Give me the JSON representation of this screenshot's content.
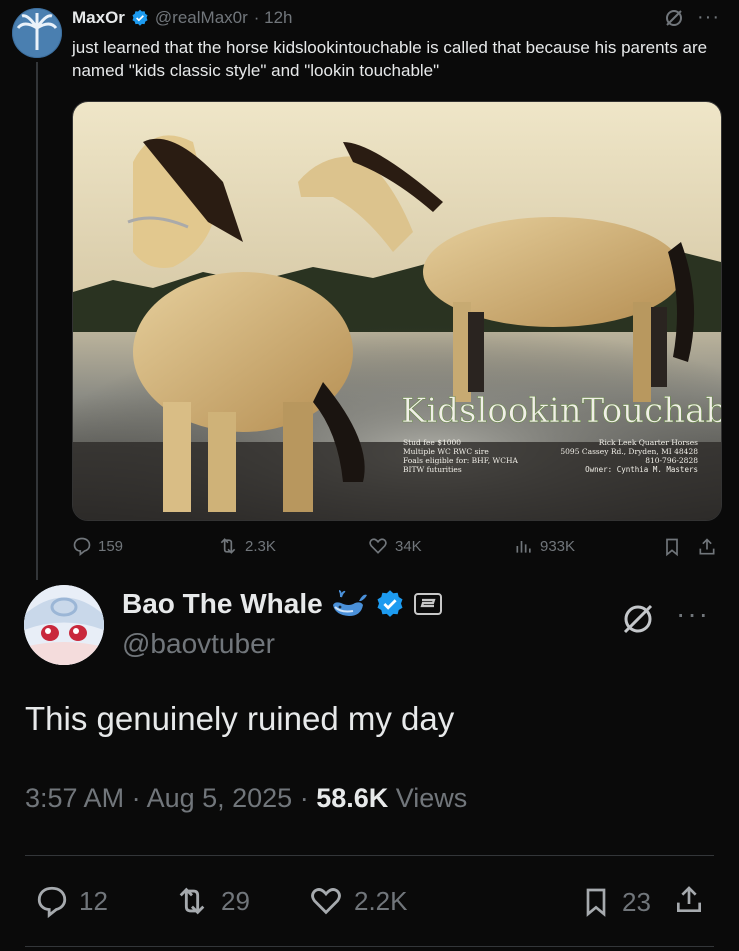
{
  "quoted": {
    "name": "MaxOr",
    "handle": "@realMax0r",
    "time": "· 12h",
    "text": "just learned that the horse kidslookintouchable is called that because his parents are named \"kids classic style\" and \"lookin touchable\"",
    "image": {
      "brand_title": "KidslookinTouchable",
      "left_lines": [
        "Stud fee $1000",
        "Multiple WC RWC sire",
        "Foals eligible for: BHF, WCHA",
        "BITW futurities"
      ],
      "right_lines": [
        "Rick Leek Quarter Horses",
        "5095 Cassey Rd., Dryden, MI 48428",
        "810-796-2828",
        "Owner: Cynthia M. Masters"
      ]
    },
    "actions": {
      "replies": "159",
      "reposts": "2.3K",
      "likes": "34K",
      "views": "933K"
    }
  },
  "post": {
    "name": "Bao The Whale",
    "handle": "@baovtuber",
    "text": "This genuinely ruined my day",
    "time": "3:57 AM · Aug 5, 2025 · ",
    "views_count": "58.6K",
    "views_label": " Views",
    "actions": {
      "replies": "12",
      "reposts": "29",
      "likes": "2.2K",
      "bookmarks": "23"
    }
  },
  "colors": {
    "background": "#0a0a0a",
    "text": "#e7e9ea",
    "muted": "#71767b",
    "verified": "#1d9bf0"
  },
  "icons": [
    "palm-tree-avatar",
    "verified-badge-icon",
    "grok-icon",
    "more-icon",
    "reply-icon",
    "repost-icon",
    "like-icon",
    "views-icon",
    "bookmark-icon",
    "share-icon",
    "whale-emoji-icon",
    "subscriber-badge-icon"
  ]
}
